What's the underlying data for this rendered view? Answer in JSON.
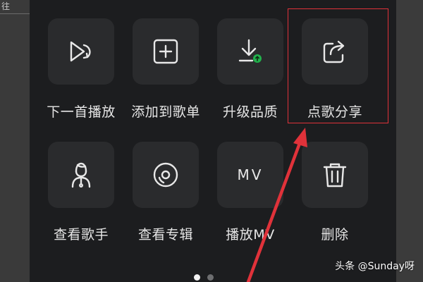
{
  "left_fragment": "往",
  "menu": {
    "items": [
      {
        "id": "play-next",
        "label": "下一首播放",
        "icon": "play-next-icon"
      },
      {
        "id": "add-to-playlist",
        "label": "添加到歌单",
        "icon": "add-square-icon"
      },
      {
        "id": "upgrade-quality",
        "label": "升级品质",
        "icon": "download-upgrade-icon"
      },
      {
        "id": "share-song",
        "label": "点歌分享",
        "icon": "share-icon"
      },
      {
        "id": "view-artist",
        "label": "查看歌手",
        "icon": "artist-icon"
      },
      {
        "id": "view-album",
        "label": "查看专辑",
        "icon": "album-disc-icon"
      },
      {
        "id": "play-mv",
        "label": "播放MV",
        "icon": "mv-icon"
      },
      {
        "id": "delete",
        "label": "删除",
        "icon": "trash-icon"
      }
    ],
    "mv_icon_text": "MV"
  },
  "pagination": {
    "pages": 2,
    "current": 1
  },
  "annotation": {
    "highlighted_item": "点歌分享",
    "color": "#e0323a"
  },
  "colors": {
    "panel_bg": "#1c1d1f",
    "tile_bg": "#2a2b2d",
    "accent_green": "#22b14c",
    "annotation_red": "#e0323a"
  },
  "watermark": "头条 @Sunday呀"
}
